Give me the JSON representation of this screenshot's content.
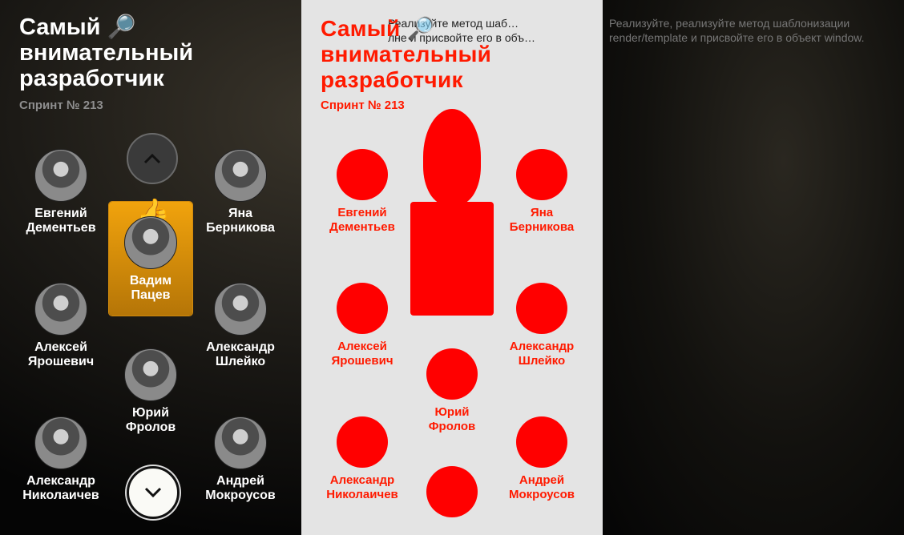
{
  "title": "Самый 🔎 внимательный разработчик",
  "subtitle": "Спринт № 213",
  "leader": {
    "first": "Вадим",
    "last": "Пацев",
    "emoji": "👍"
  },
  "people": [
    {
      "first": "Евгений",
      "last": "Дементьев"
    },
    {
      "first": "Яна",
      "last": "Берникова"
    },
    {
      "first": "Алексей",
      "last": "Ярошевич"
    },
    {
      "first": "Александр",
      "last": "Шлейко"
    },
    {
      "first": "Юрий",
      "last": "Фролов"
    },
    {
      "first": "Александр",
      "last": "Николаичев"
    },
    {
      "first": "Андрей",
      "last": "Мокроусов"
    }
  ],
  "middle_note": "Реализуйте метод шаб…\nлне и присвойте его в объ…",
  "right_note": "Реализуйте, реализуйте метод шаблонизации\nrender/template и присвойте его в объект window."
}
